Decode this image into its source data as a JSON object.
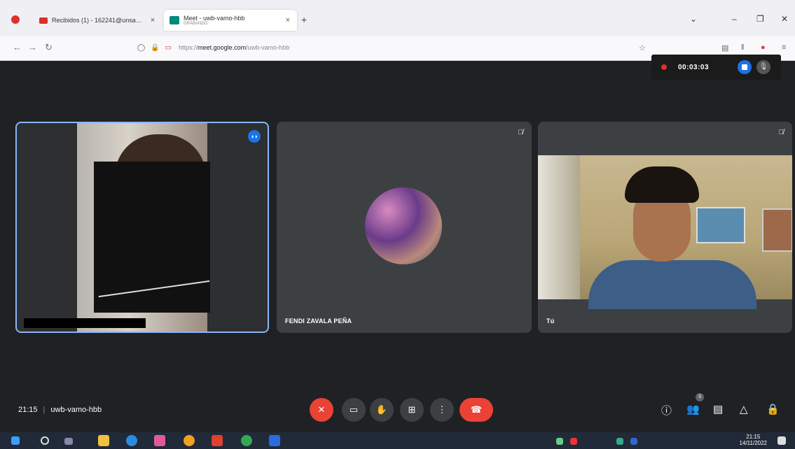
{
  "browser": {
    "tabs": [
      {
        "label": "Recibidos (1) - 162241@unsa…",
        "active": false
      },
      {
        "label": "Meet - uwb-vamo-hbb",
        "sublabel": "GRABANDO",
        "active": true
      }
    ],
    "new_tab": "+",
    "url_host": "meet.google.com",
    "url_prefix": "https://",
    "url_path": "/uwb-vamo-hbb"
  },
  "recording": {
    "time": "00:03:03"
  },
  "tiles": [
    {
      "name": "",
      "speaking": true
    },
    {
      "name": "FENDI ZAVALA PEÑA",
      "muted": true
    },
    {
      "name": "Tú",
      "muted": true
    }
  ],
  "meeting": {
    "time": "21:15",
    "separator": "|",
    "code": "uwb-vamo-hbb"
  },
  "controls": {
    "mic": "✕",
    "camera": "▭",
    "hand": "✋",
    "present": "⊞",
    "more": "⋮",
    "end": "☎"
  },
  "right_controls": {
    "info": "ⓘ",
    "people": "👥",
    "people_count": "3",
    "chat": "▤",
    "activities": "△",
    "host": "🔒"
  },
  "taskbar": {
    "time": "21:15",
    "date": "14/11/2022"
  },
  "colors": {
    "accent": "#1a73e8",
    "danger": "#ea4335",
    "bg": "#202124",
    "tile": "#3c4043"
  }
}
